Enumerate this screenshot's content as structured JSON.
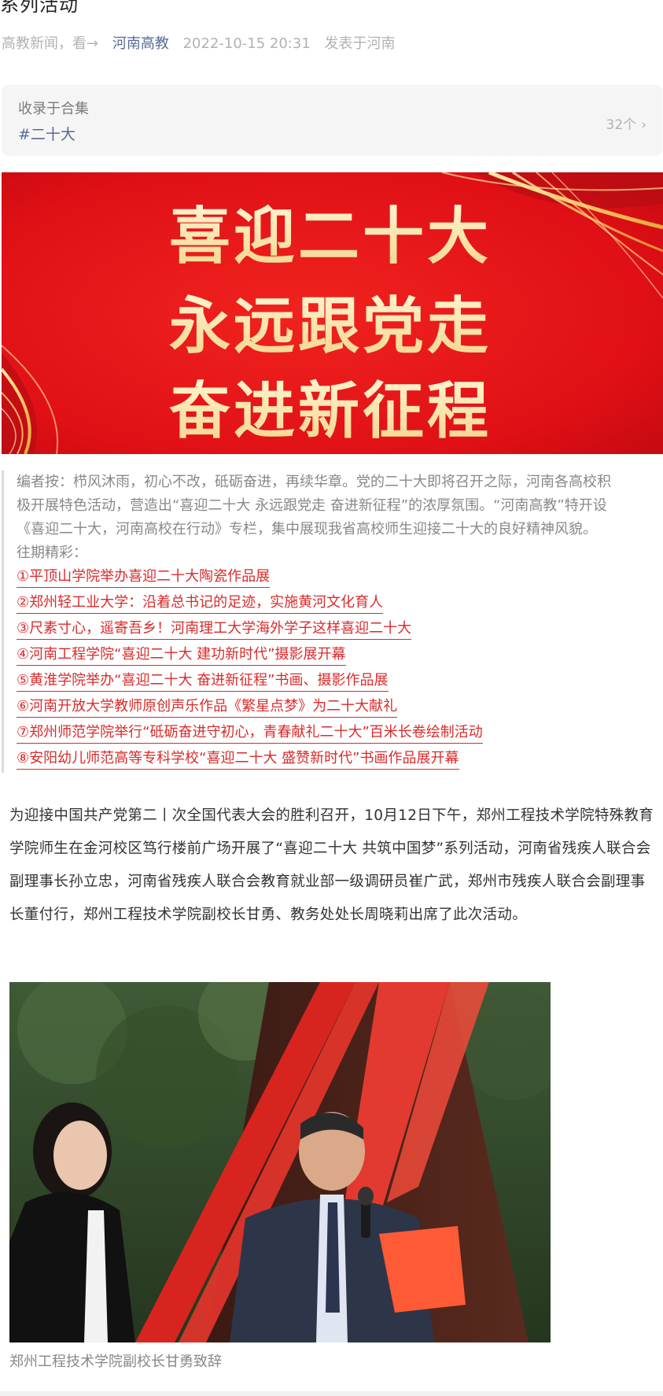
{
  "article": {
    "title_tail": "系列活动",
    "meta": {
      "source": "高教新闻，看→",
      "account": "河南高教",
      "datetime": "2022-10-15 20:31",
      "location": "发表于河南"
    }
  },
  "collection": {
    "label": "收录于合集",
    "tag": "#二十大",
    "count": "32个"
  },
  "banner": {
    "lines": [
      "喜迎二十大",
      "永远跟党走",
      "奋进新征程"
    ]
  },
  "editor_note": {
    "paragraph_lines": [
      "编者按：栉风沐雨，初心不改，砥砺奋进，再续华章。党的二十大即将召开之际，河南各高校积",
      "极开展特色活动，营造出“喜迎二十大 永远跟党走 奋进新征程”的浓厚氛围。“河南高教”特开设",
      "《喜迎二十大，河南高校在行动》专栏，集中展现我省高校师生迎接二十大的良好精神风貌。"
    ],
    "past_label": "往期精彩：",
    "links": [
      "①平顶山学院举办喜迎二十大陶瓷作品展",
      "②郑州轻工业大学：沿着总书记的足迹，实施黄河文化育人",
      "③尺素寸心，遥寄吾乡！河南理工大学海外学子这样喜迎二十大",
      "④河南工程学院“喜迎二十大 建功新时代”摄影展开幕",
      "⑤黄淮学院举办“喜迎二十大 奋进新征程”书画、摄影作品展",
      "⑥河南开放大学教师原创声乐作品《繁星点梦》为二十大献礼",
      "⑦郑州师范学院举行“砥砺奋进守初心，青春献礼二十大”百米长卷绘制活动",
      "⑧安阳幼儿师范高等专科学校“喜迎二十大 盛赞新时代”书画作品展开幕"
    ]
  },
  "body": {
    "paragraph": "为迎接中国共产党第二丨次全国代表大会的胜利召开，10月12日下午，郑州工程技术学院特殊教育学院师生在金河校区笃行楼前广场开展了“喜迎二十大 共筑中国梦”系列活动，河南省残疾人联合会副理事长孙立忠，河南省残疾人联合会教育就业部一级调研员崔广武，郑州市残疾人联合会副理事长董付行，郑州工程技术学院副校长甘勇、教务处处长周晓莉出席了此次活动。"
  },
  "photo": {
    "caption": "郑州工程技术学院副校长甘勇致辞"
  },
  "colors": {
    "link": "#d92b2b",
    "account": "#576b95",
    "banner_red": "#e4141b",
    "banner_text": "#f7e2a4"
  }
}
